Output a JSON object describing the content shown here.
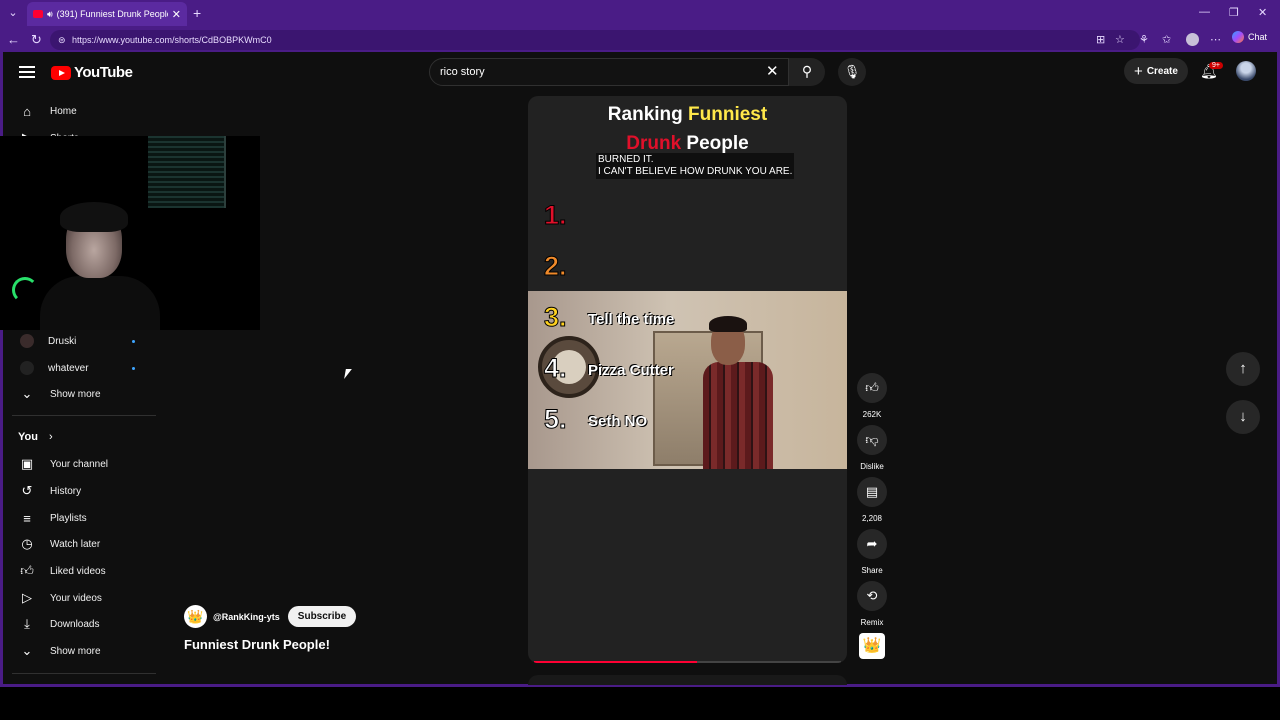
{
  "browser": {
    "tab_title": "(391) Funniest Drunk People!",
    "url": "https://www.youtube.com/shorts/CdBOBPKWmC0",
    "chat_label": "Chat"
  },
  "header": {
    "logo_text": "YouTube",
    "search_value": "rico story",
    "create_label": "Create",
    "notification_badge": "9+"
  },
  "sidebar": {
    "items_top": [
      {
        "label": "Home",
        "icon": "home-icon"
      },
      {
        "label": "Shorts",
        "icon": "shorts-icon"
      }
    ],
    "subscriptions": [
      {
        "label": "Druski"
      },
      {
        "label": "whatever"
      }
    ],
    "show_more_label": "Show more",
    "you_label": "You",
    "you_items": [
      {
        "label": "Your channel",
        "icon": "channel-icon"
      },
      {
        "label": "History",
        "icon": "history-icon"
      },
      {
        "label": "Playlists",
        "icon": "playlists-icon"
      },
      {
        "label": "Watch later",
        "icon": "watch-later-icon"
      },
      {
        "label": "Liked videos",
        "icon": "liked-icon"
      },
      {
        "label": "Your videos",
        "icon": "your-videos-icon"
      },
      {
        "label": "Downloads",
        "icon": "downloads-icon"
      }
    ],
    "show_more_2_label": "Show more"
  },
  "short": {
    "title_line1_a": "Ranking ",
    "title_line1_b": "Funniest",
    "title_line2_a": "Drunk",
    "title_line2_b": " People",
    "caption_line1": "BURNED IT.",
    "caption_line2": "I CAN'T BELIEVE HOW DRUNK YOU ARE.",
    "ranks": [
      {
        "num": "1.",
        "label": "",
        "color": "#e0102a"
      },
      {
        "num": "2.",
        "label": "",
        "color": "#f08a2a"
      },
      {
        "num": "3.",
        "label": "Tell the time",
        "color": "#ffd21f"
      },
      {
        "num": "4.",
        "label": "Pizza Cutter",
        "color": "#ffffff"
      },
      {
        "num": "5.",
        "label": "Seth NO",
        "color": "#ffffff"
      }
    ],
    "progress": 0.53
  },
  "actions": {
    "like_count": "262K",
    "dislike_label": "Dislike",
    "comment_count": "2,208",
    "share_label": "Share",
    "remix_label": "Remix"
  },
  "channel": {
    "handle": "@RankKing-yts",
    "subscribe_label": "Subscribe",
    "video_title": "Funniest Drunk People!"
  },
  "colors": {
    "browser_frame": "#4a1c86",
    "youtube_red": "#ff0000",
    "page_bg": "#0f0f0f",
    "accent_yellow": "#ffe84a"
  }
}
